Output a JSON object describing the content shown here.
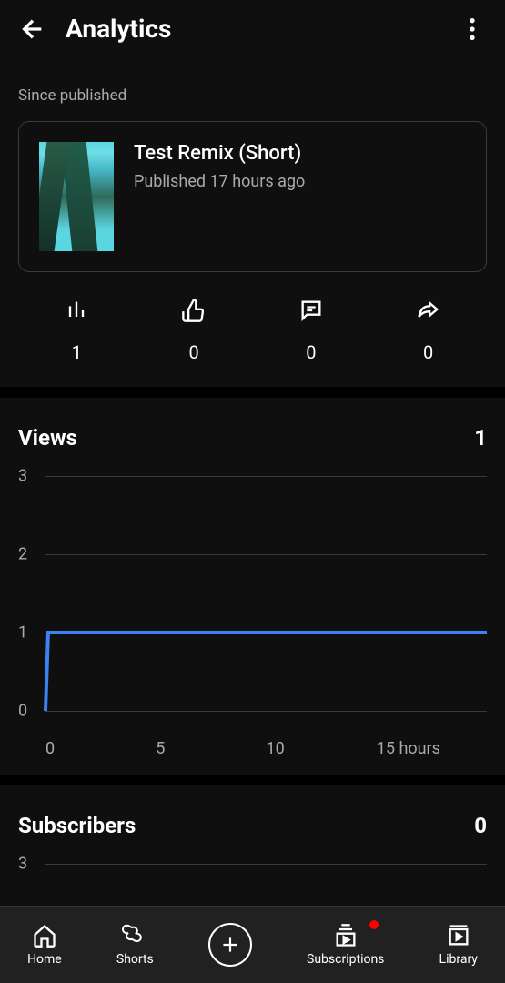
{
  "header": {
    "title": "Analytics"
  },
  "since_label": "Since published",
  "video": {
    "title": "Test Remix (Short)",
    "published": "Published 17 hours ago"
  },
  "stats": {
    "views": "1",
    "likes": "0",
    "comments": "0",
    "shares": "0"
  },
  "views_section": {
    "title": "Views",
    "value": "1",
    "y_ticks": [
      "3",
      "2",
      "1",
      "0"
    ],
    "x_ticks": [
      "0",
      "5",
      "10",
      "15 hours"
    ]
  },
  "subscribers_section": {
    "title": "Subscribers",
    "value": "0",
    "y_tick_top": "3"
  },
  "nav": {
    "home": "Home",
    "shorts": "Shorts",
    "subscriptions": "Subscriptions",
    "library": "Library"
  },
  "chart_data": {
    "type": "line",
    "title": "Views",
    "xlabel": "hours",
    "ylabel": "Views",
    "ylim": [
      0,
      3
    ],
    "x": [
      0,
      1,
      2,
      3,
      4,
      5,
      6,
      7,
      8,
      9,
      10,
      11,
      12,
      13,
      14,
      15,
      16,
      17
    ],
    "values": [
      0,
      1,
      1,
      1,
      1,
      1,
      1,
      1,
      1,
      1,
      1,
      1,
      1,
      1,
      1,
      1,
      1,
      1
    ]
  }
}
